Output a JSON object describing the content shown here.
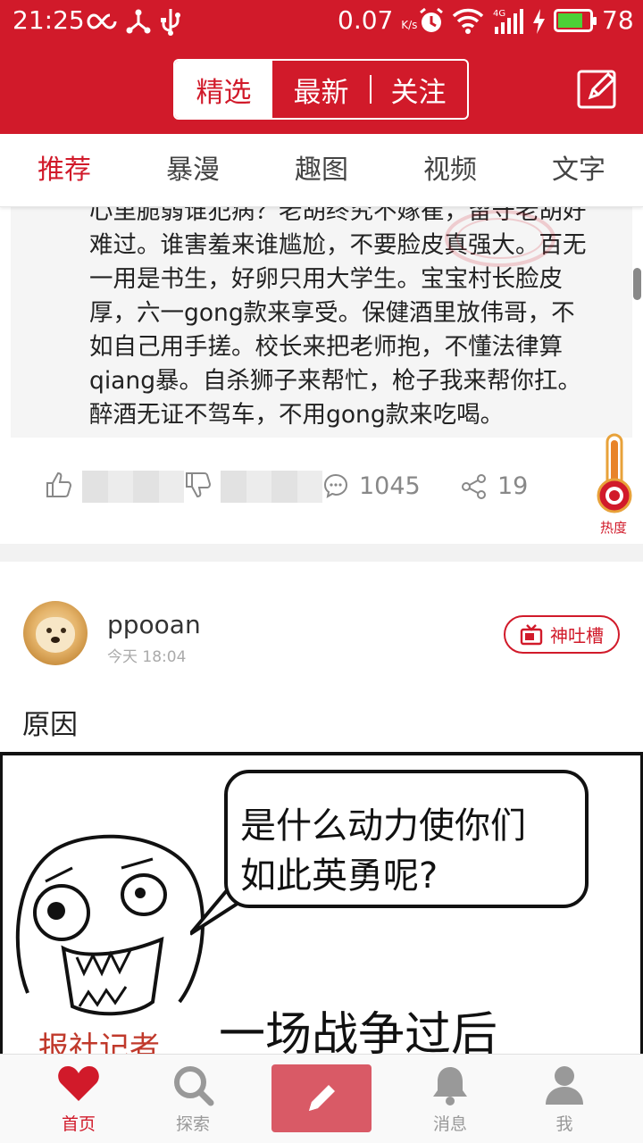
{
  "status_bar": {
    "time": "21:25",
    "speed": "0.07",
    "speed_unit": "K/s",
    "network": "4G",
    "battery": "78",
    "battery_level": 0.78
  },
  "header": {
    "segments": [
      "精选",
      "最新",
      "关注"
    ],
    "active_segment": "精选"
  },
  "tabs": [
    "推荐",
    "暴漫",
    "趣图",
    "视频",
    "文字"
  ],
  "active_tab": "推荐",
  "quote": {
    "lines": [
      "心里脆弱谁犯病？老胡终究不嫁崔，留守老胡好",
      "难过。谁害羞来谁尴尬，不要脸皮真强大。百无",
      "一用是书生，好卵只用大学生。宝宝村长脸皮",
      "厚，六一gong款来享受。保健酒里放伟哥，不",
      "如自己用手搓。校长来把老师抱，不懂法律算",
      "qiang暴。自杀狮子来帮忙，枪子我来帮你扛。",
      "醉酒无证不驾车，不用gong款来吃喝。"
    ]
  },
  "actions": {
    "comments": "1045",
    "shares": "19",
    "heat_label": "热度"
  },
  "post": {
    "username": "ppooan",
    "time": "今天 18:04",
    "tag": "神吐槽",
    "title": "原因",
    "comic": {
      "bubble_line1": "是什么动力使你们",
      "bubble_line2": "如此英勇呢?",
      "caption": "一场战争过后",
      "reporter": "报社记者"
    }
  },
  "bottom_nav": {
    "home": "首页",
    "explore": "探索",
    "messages": "消息",
    "me": "我"
  },
  "colors": {
    "brand_red": "#d11a2a",
    "post_button": "#d95a66"
  }
}
